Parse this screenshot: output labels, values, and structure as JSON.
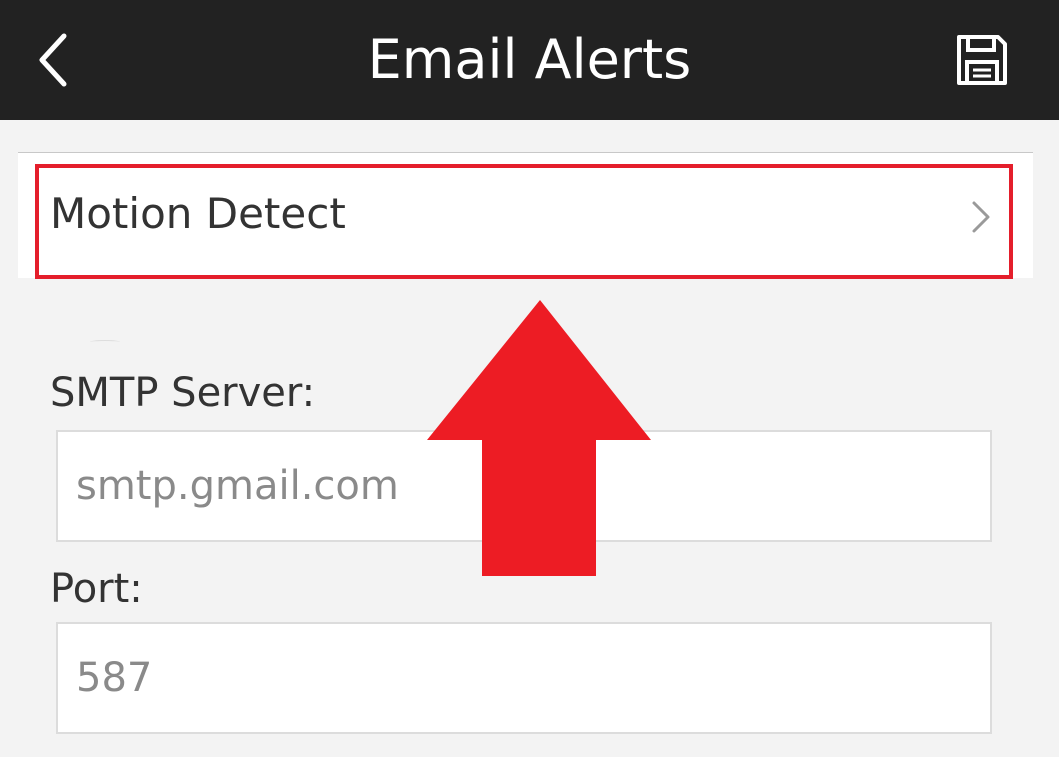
{
  "header": {
    "title": "Email Alerts",
    "back_icon": "chevron-left-icon",
    "save_icon": "floppy-disk-icon"
  },
  "motion_detect": {
    "label": "Motion Detect",
    "chevron_icon": "chevron-right-icon"
  },
  "smtp_server": {
    "label": "SMTP Server:",
    "placeholder": "smtp.gmail.com",
    "value": ""
  },
  "port": {
    "label": "Port:",
    "placeholder": "587",
    "value": ""
  },
  "annotation": {
    "highlight_color": "#e41e2b",
    "arrow_icon": "up-arrow-icon"
  },
  "colors": {
    "header_bg": "#222222",
    "page_bg": "#f3f3f3",
    "accent_red": "#e41e2b"
  }
}
